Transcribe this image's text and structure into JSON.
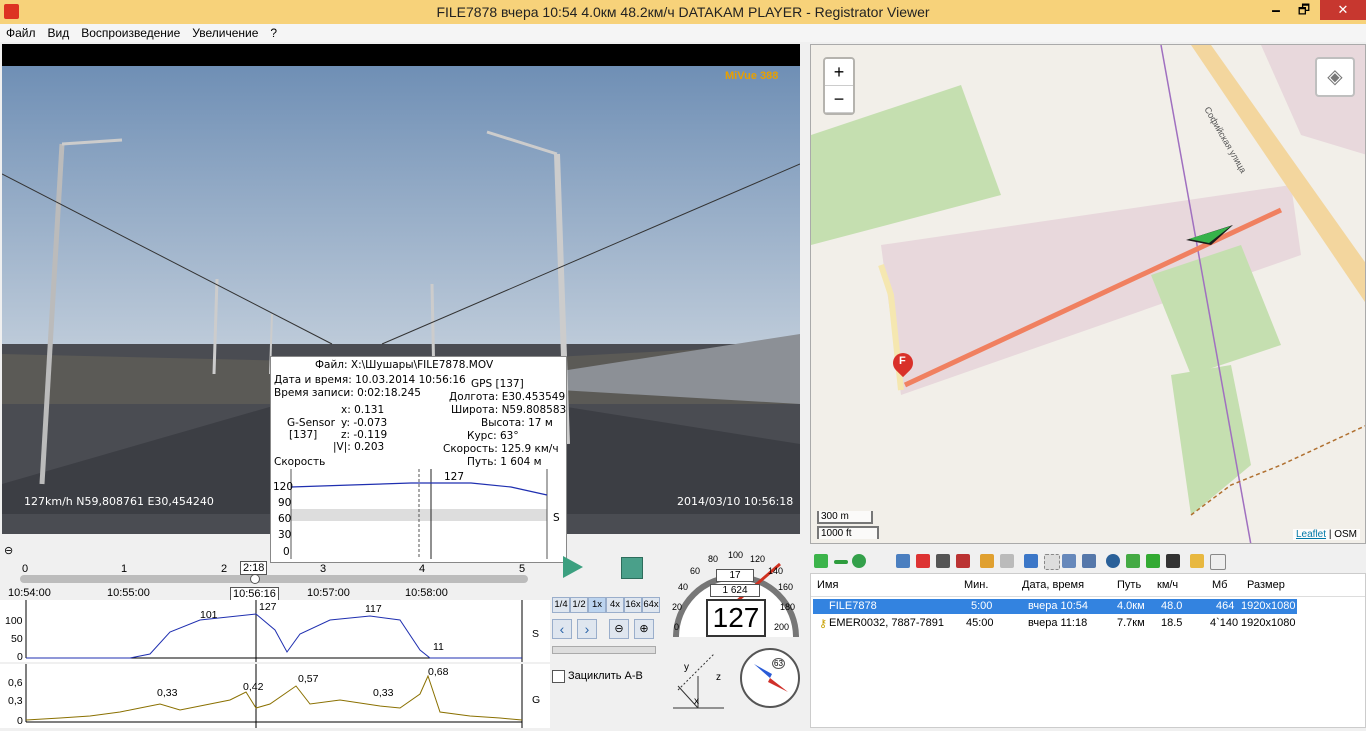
{
  "window": {
    "title": "FILE7878     вчера 10:54     4.0км     48.2км/ч     DATAKAM PLAYER - Registrator Viewer",
    "minimize": "🗕",
    "maximize": "🗗",
    "close": "✕"
  },
  "menu": [
    "Файл",
    "Вид",
    "Воспроизведение",
    "Увеличение",
    "?"
  ],
  "video": {
    "brand": "MiVue 388",
    "overlay_left": "127km/h N59,808761 E30,454240",
    "overlay_right": "2014/03/10 10:56:18"
  },
  "info": {
    "file": "Файл: X:\\Шушары\\FILE7878.MOV",
    "datetime": "Дата и время: 10.03.2014 10:56:16",
    "rec_time": "Время записи: 0:02:18.245",
    "gsensor_label": "G-Sensor",
    "gsensor_idx": "[137]",
    "gx": "x:  0.131",
    "gy": "y: -0.073",
    "gz": "z: -0.119",
    "gm": "|V|:  0.203",
    "gps": "GPS [137]",
    "lon": "Долгота: E30.453549",
    "lat": "Широта: N59.808583",
    "alt": "Высота: 17 м",
    "course": "Курс: 63°",
    "speed": "Скорость: 125.9 км/ч",
    "path": "Путь: 1 604 м",
    "chart_title": "Скорость",
    "chart_peak": "127",
    "chart_axis": "S",
    "yticks": [
      "120",
      "90",
      "60",
      "30",
      "0"
    ]
  },
  "map": {
    "zoom_in": "+",
    "zoom_out": "−",
    "street": "Софийская улица",
    "marker": "F",
    "scale_m": "300 m",
    "scale_ft": "1000 ft",
    "attrib_link": "Leaflet",
    "attrib": "| OSM"
  },
  "timeline": {
    "ticks": [
      "0",
      "1",
      "2",
      "3",
      "4",
      "5"
    ],
    "current": "2:18",
    "times": [
      "10:54:00",
      "10:55:00",
      "10:56:16",
      "10:57:00",
      "10:58:00"
    ]
  },
  "graphS": {
    "yticks": [
      "100",
      "50",
      "0"
    ],
    "labels": [
      "101",
      "127",
      "117",
      "11"
    ],
    "axis": "S"
  },
  "graphG": {
    "yticks": [
      "0,6",
      "0,3",
      "0"
    ],
    "labels": [
      "0,33",
      "0,42",
      "0,57",
      "0,33",
      "0,68"
    ],
    "axis": "G"
  },
  "speed_buttons": [
    "1/4",
    "1/2",
    "1x",
    "4x",
    "16x",
    "64x"
  ],
  "loop_label": "Зациклить А-В",
  "gauge": {
    "speed": "127",
    "odo_top": "17",
    "odo_mid": "1 624",
    "scale": [
      "0",
      "20",
      "40",
      "60",
      "80",
      "100",
      "120",
      "140",
      "160",
      "180",
      "200"
    ]
  },
  "compass": {
    "course": "63"
  },
  "filelist": {
    "headers": [
      "Имя",
      "Мин.",
      "Дата, время",
      "Путь",
      "км/ч",
      "Мб",
      "Размер"
    ],
    "rows": [
      {
        "name": "FILE7878",
        "min": "5:00",
        "date": "вчера 10:54",
        "path": "4.0км",
        "speed": "48.0",
        "mb": "464",
        "size": "1920x1080"
      },
      {
        "name": "EMER0032, 7887-7891",
        "min": "45:00",
        "date": "вчера 11:18",
        "path": "7.7км",
        "speed": "18.5",
        "mb": "4`140",
        "size": "1920x1080"
      }
    ]
  },
  "colors": {
    "titlebar": "#f7d27a",
    "track": "#f08060",
    "speedline": "#1f2fb0",
    "gline": "#8a7000"
  }
}
